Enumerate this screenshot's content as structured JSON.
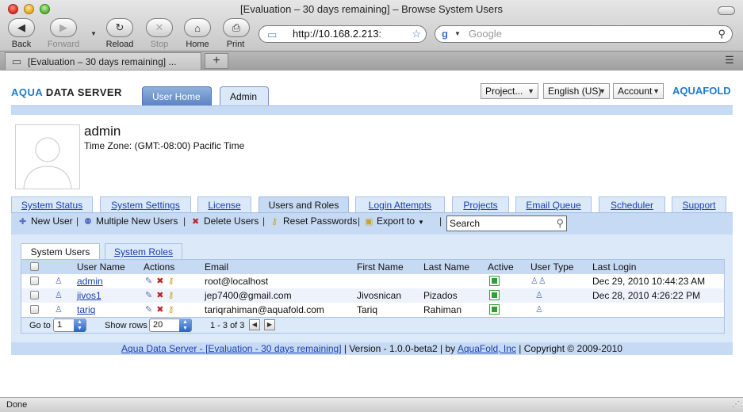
{
  "browser": {
    "window_title": "[Evaluation – 30 days remaining] – Browse System Users",
    "nav": {
      "back": "Back",
      "forward": "Forward",
      "reload": "Reload",
      "stop": "Stop",
      "home": "Home",
      "print": "Print"
    },
    "url": "http://10.168.2.213:",
    "search_placeholder": "Google",
    "tab_title": "[Evaluation – 30 days remaining] ...",
    "status": "Done"
  },
  "app": {
    "logo": {
      "prefix": "AQUA",
      "suffix": " DATA SERVER"
    },
    "brand": "AQUAFOLD",
    "top_tabs": {
      "user_home": "User Home",
      "admin": "Admin"
    },
    "menus": {
      "project": "Project...",
      "language": "English (US)",
      "account": "Account"
    },
    "profile": {
      "username": "admin",
      "timezone": "Time Zone: (GMT:-08:00) Pacific Time"
    },
    "admin_tabs": [
      "System Status",
      "System Settings",
      "License",
      "Users and Roles",
      "Login Attempts",
      "Projects",
      "Email Queue",
      "Scheduler",
      "Support"
    ],
    "toolbar": {
      "new_user": "New User",
      "multiple_new_users": "Multiple New Users",
      "delete_users": "Delete Users",
      "reset_passwords": "Reset Passwords",
      "export_to": "Export to",
      "search": "Search"
    },
    "sub_tabs": {
      "system_users": "System Users",
      "system_roles": "System Roles"
    },
    "table": {
      "headers": {
        "user_name": "User Name",
        "actions": "Actions",
        "email": "Email",
        "first_name": "First Name",
        "last_name": "Last Name",
        "active": "Active",
        "user_type": "User Type",
        "last_login": "Last Login"
      },
      "rows": [
        {
          "user_name": "admin",
          "email": "root@localhost",
          "first_name": "",
          "last_name": "",
          "last_login": "Dec 29, 2010 10:44:23 AM"
        },
        {
          "user_name": "jivos1",
          "email": "jep7400@gmail.com",
          "first_name": "Jivosnican",
          "last_name": "Pizados",
          "last_login": "Dec 28, 2010 4:26:22 PM"
        },
        {
          "user_name": "tariq",
          "email": "tariqrahiman@aquafold.com",
          "first_name": "Tariq",
          "last_name": "Rahiman",
          "last_login": ""
        }
      ]
    },
    "pager": {
      "goto_label": "Go to",
      "goto_value": "1",
      "show_rows_label": "Show rows",
      "show_rows_value": "20",
      "range": "1 - 3 of 3"
    },
    "footer": {
      "link1": "Aqua Data Server - [Evaluation - 30 days remaining]",
      "version": " | Version - 1.0.0-beta2 | by ",
      "link2": "AquaFold, Inc",
      "copyright": " | Copyright © 2009-2010"
    }
  }
}
